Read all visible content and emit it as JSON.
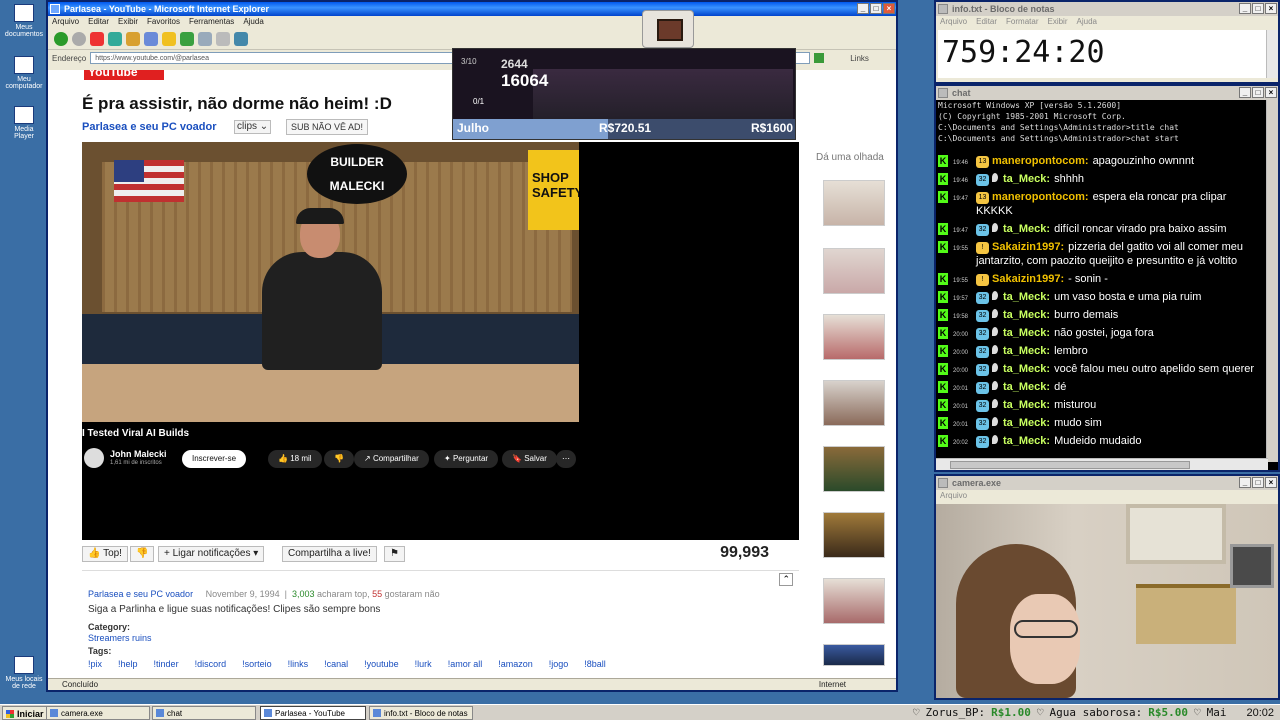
{
  "desktop": {
    "icons": [
      "Meus documentos",
      "Meu computador",
      "Media Player",
      "Meus locais de rede"
    ]
  },
  "ie": {
    "title": "Parlasea - YouTube - Microsoft Internet Explorer",
    "menu": [
      "Arquivo",
      "Editar",
      "Exibir",
      "Favoritos",
      "Ferramentas",
      "Ajuda"
    ],
    "address_label": "Endereço",
    "address": "https://www.youtube.com/@parlasea",
    "links_label": "Links",
    "status_text": "Concluído",
    "zone": "Internet"
  },
  "page": {
    "logo": "YouTube",
    "video_title": "É pra assistir, não dorme não heim! :D",
    "channel_link": "Parlasea e seu PC voador",
    "clips_label": "clips",
    "sub_button": "SUB NÃO VÊ AD!",
    "inner_video_title": "I Tested Viral AI Builds",
    "inner_channel": "John Malecki",
    "inner_subs": "1,61 mi de inscritos",
    "subscribe": "Inscrever-se",
    "likes": "18 mil",
    "share": "Compartilhar",
    "ask": "Perguntar",
    "save": "Salvar",
    "top_button": "Top!",
    "notif_button": "Ligar notificações",
    "share_live": "Compartilha a live!",
    "views": "99,993",
    "desc_channel": "Parlasea e seu PC voador",
    "desc_date": "November 9, 1994",
    "desc_sep": "|",
    "desc_likes_num": "3,003",
    "desc_likes_text": "acharam top,",
    "desc_dislikes_num": "55",
    "desc_dislikes_text": "gostaram não",
    "desc_text": "Siga a Parlinha e ligue suas notificações! Clipes são sempre bons",
    "category_label": "Category:",
    "category": "Streamers ruins",
    "tags_label": "Tags:",
    "tags": [
      "!pix",
      "!help",
      "!tinder",
      "!discord",
      "!sorteio",
      "!links",
      "!canal",
      "!youtube",
      "!lurk",
      "!amor all",
      "!amazon",
      "!jogo",
      "!8ball"
    ],
    "sidebar_title": "Dá uma olhada"
  },
  "game": {
    "level": "3/10",
    "coins": "2644",
    "score": "16064",
    "hp": "0/1",
    "month": "Julho",
    "current": "R$720.51",
    "goal": "R$1600",
    "progress": 0.45
  },
  "notepad": {
    "title": "info.txt - Bloco de notas",
    "menu": [
      "Arquivo",
      "Editar",
      "Formatar",
      "Exibir",
      "Ajuda"
    ],
    "text": "759:24:20"
  },
  "chat": {
    "title": "chat",
    "header_lines": [
      "Microsoft Windows XP [versão 5.1.2600]",
      "(C) Copyright 1985-2001 Microsoft Corp.",
      "C:\\Documents and Settings\\Administrador>title chat",
      "C:\\Documents and Settings\\Administrador>chat start"
    ],
    "messages": [
      {
        "time": "19:46",
        "badge": "13",
        "badge_color": "#f5c542",
        "drop": false,
        "user": "maneropontocom:",
        "color": "#f0c000",
        "text": "apagouzinho ownnnt"
      },
      {
        "time": "19:46",
        "badge": "32",
        "badge_color": "#6bc3e8",
        "drop": true,
        "user": "ta_Meck:",
        "color": "#c8ff60",
        "text": "shhhh"
      },
      {
        "time": "19:47",
        "badge": "13",
        "badge_color": "#f5c542",
        "drop": false,
        "user": "maneropontocom:",
        "color": "#f0c000",
        "text": "espera ela roncar pra clipar KKKKK"
      },
      {
        "time": "19:47",
        "badge": "32",
        "badge_color": "#6bc3e8",
        "drop": true,
        "user": "ta_Meck:",
        "color": "#c8ff60",
        "text": "difícil roncar virado pra baixo assim"
      },
      {
        "time": "19:55",
        "badge": "!",
        "badge_color": "#f5c542",
        "drop": false,
        "user": "Sakaizin1997:",
        "color": "#f0c000",
        "text": "pizzeria del gatito voi all comer meu jantarzito, com paozito queijito e presuntito e já voltito"
      },
      {
        "time": "19:55",
        "badge": "!",
        "badge_color": "#f5c542",
        "drop": false,
        "user": "Sakaizin1997:",
        "color": "#f0c000",
        "text": "- sonin -"
      },
      {
        "time": "19:57",
        "badge": "32",
        "badge_color": "#6bc3e8",
        "drop": true,
        "user": "ta_Meck:",
        "color": "#c8ff60",
        "text": "um vaso bosta e uma pia ruim"
      },
      {
        "time": "19:58",
        "badge": "32",
        "badge_color": "#6bc3e8",
        "drop": true,
        "user": "ta_Meck:",
        "color": "#c8ff60",
        "text": "burro demais"
      },
      {
        "time": "20:00",
        "badge": "32",
        "badge_color": "#6bc3e8",
        "drop": true,
        "user": "ta_Meck:",
        "color": "#c8ff60",
        "text": "não gostei, joga fora"
      },
      {
        "time": "20:00",
        "badge": "32",
        "badge_color": "#6bc3e8",
        "drop": true,
        "user": "ta_Meck:",
        "color": "#c8ff60",
        "text": "lembro"
      },
      {
        "time": "20:00",
        "badge": "32",
        "badge_color": "#6bc3e8",
        "drop": true,
        "user": "ta_Meck:",
        "color": "#c8ff60",
        "text": "você falou meu outro apelido sem querer"
      },
      {
        "time": "20:01",
        "badge": "32",
        "badge_color": "#6bc3e8",
        "drop": true,
        "user": "ta_Meck:",
        "color": "#c8ff60",
        "text": "dé"
      },
      {
        "time": "20:01",
        "badge": "32",
        "badge_color": "#6bc3e8",
        "drop": true,
        "user": "ta_Meck:",
        "color": "#c8ff60",
        "text": "misturou"
      },
      {
        "time": "20:01",
        "badge": "32",
        "badge_color": "#6bc3e8",
        "drop": true,
        "user": "ta_Meck:",
        "color": "#c8ff60",
        "text": "mudo sim"
      },
      {
        "time": "20:02",
        "badge": "32",
        "badge_color": "#6bc3e8",
        "drop": true,
        "user": "ta_Meck:",
        "color": "#c8ff60",
        "text": "Mudeido mudaido"
      }
    ]
  },
  "camera": {
    "title": "camera.exe",
    "menu": [
      "Arquivo"
    ]
  },
  "taskbar": {
    "start": "Iniciar",
    "tasks": [
      "camera.exe",
      "chat",
      "Parlasea - YouTube",
      "info.txt - Bloco de notas"
    ],
    "tray_items": [
      {
        "name": "Zorus_BP:",
        "value": "R$1.00"
      },
      {
        "name": "Agua saborosa:",
        "value": "R$5.00"
      },
      {
        "name": "Mai",
        "value": ""
      }
    ],
    "clock": "20:02"
  }
}
